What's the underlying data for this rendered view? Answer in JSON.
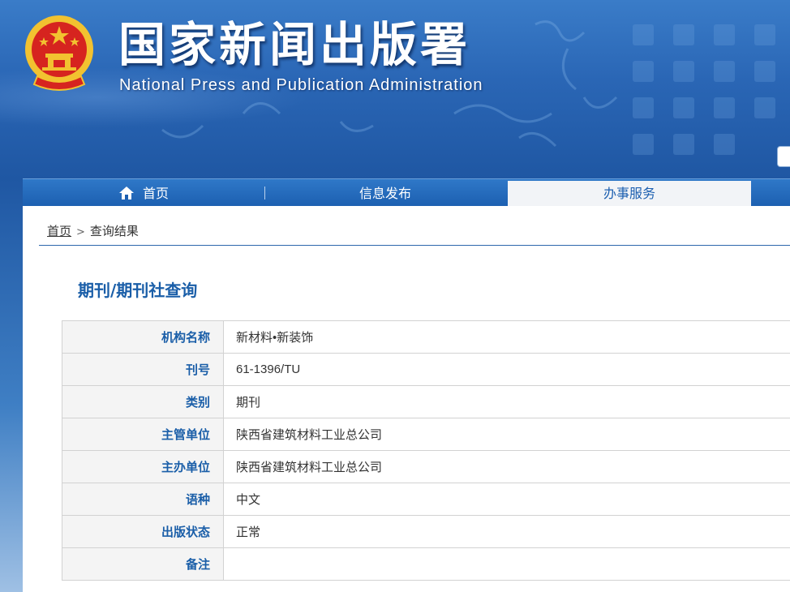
{
  "header": {
    "title": "国家新闻出版署",
    "subtitle": "National  Press and Publication Administration"
  },
  "nav": {
    "home_label": "首页",
    "items": [
      {
        "label": "信息发布",
        "active": false
      },
      {
        "label": "办事服务",
        "active": true
      }
    ]
  },
  "breadcrumb": {
    "home": "首页",
    "separator": ">",
    "current": "查询结果"
  },
  "page": {
    "title": "期刊/期刊社查询"
  },
  "table": {
    "rows": [
      {
        "label": "机构名称",
        "value": "新材料•新装饰"
      },
      {
        "label": "刊号",
        "value": "61-1396/TU"
      },
      {
        "label": "类别",
        "value": "期刊"
      },
      {
        "label": "主管单位",
        "value": "陕西省建筑材料工业总公司"
      },
      {
        "label": "主办单位",
        "value": "陕西省建筑材料工业总公司"
      },
      {
        "label": "语种",
        "value": "中文"
      },
      {
        "label": "出版状态",
        "value": "正常"
      },
      {
        "label": "备注",
        "value": ""
      }
    ]
  },
  "colors": {
    "brand_blue": "#1a5ea8",
    "nav_blue": "#1c5fb0",
    "active_tab_bg": "#f2f4f7",
    "emblem_red": "#d6241f",
    "emblem_gold": "#f2c230"
  },
  "icons": {
    "home": "home-icon",
    "emblem": "national-emblem-icon"
  }
}
